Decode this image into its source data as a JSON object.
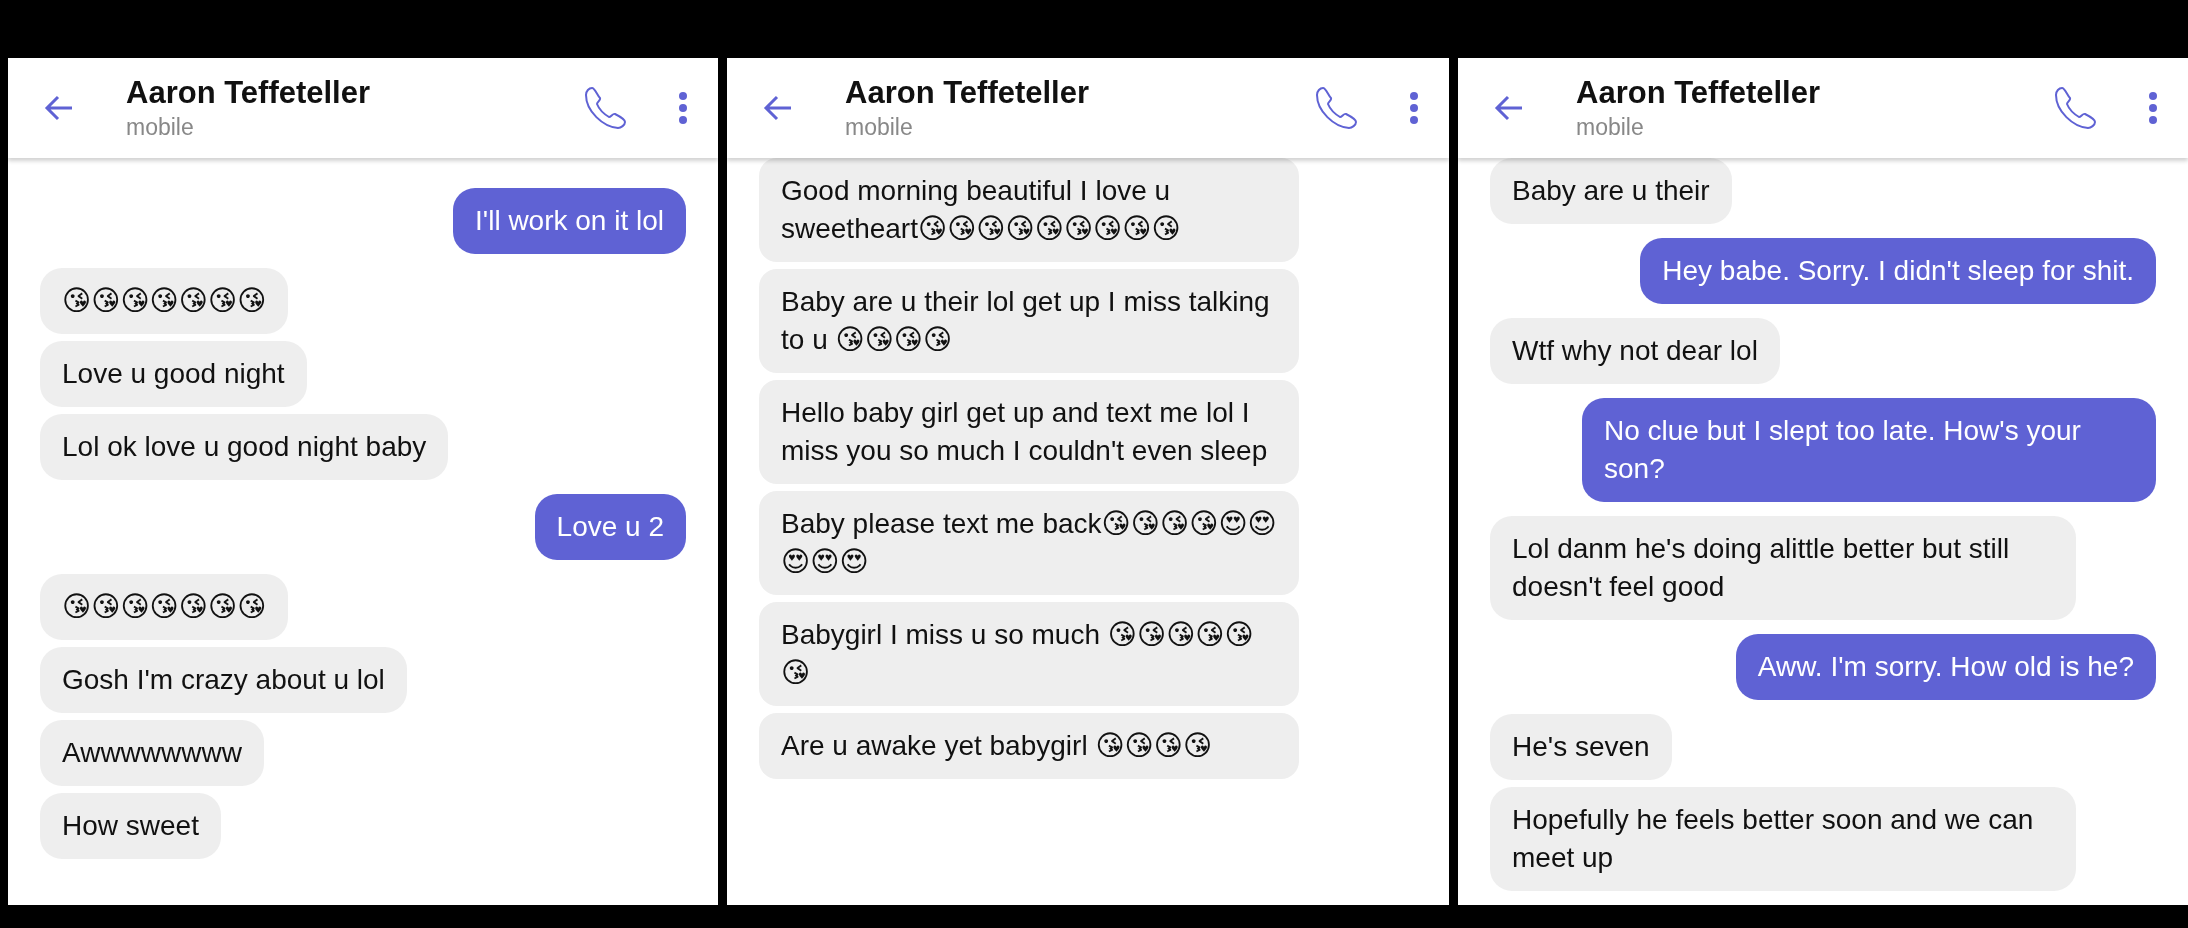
{
  "panels": [
    {
      "header": {
        "contact_name": "Aaron Teffeteller",
        "subtitle": "mobile"
      },
      "messages": [
        {
          "kind": "sent",
          "text": "I'll work on it lol"
        },
        {
          "kind": "received",
          "text": "😘😘😘😘😘😘😘"
        },
        {
          "kind": "received",
          "text": "Love u good night"
        },
        {
          "kind": "received",
          "text": "Lol ok love u good night baby"
        },
        {
          "kind": "sent",
          "text": "Love u 2"
        },
        {
          "kind": "received",
          "text": "😘😘😘😘😘😘😘"
        },
        {
          "kind": "received",
          "text": "Gosh I'm crazy about u lol"
        },
        {
          "kind": "received",
          "text": "Awwwwwwww"
        },
        {
          "kind": "received",
          "text": "How sweet"
        }
      ]
    },
    {
      "header": {
        "contact_name": "Aaron Teffeteller",
        "subtitle": "mobile"
      },
      "messages": [
        {
          "kind": "received",
          "text": "Good morning beautiful I love u sweetheart😘😘😘😘😘😘😘😘😘"
        },
        {
          "kind": "received",
          "text": "Baby are u their lol get up I miss talking to u 😘😘😘😘"
        },
        {
          "kind": "received",
          "text": "Hello baby girl get up and text me lol I miss you so much I couldn't even sleep"
        },
        {
          "kind": "received",
          "text": "Baby please text me back😘😘😘😘😍😍😍😍😍"
        },
        {
          "kind": "received",
          "text": "Babygirl I miss u so much 😘😘😘😘😘😘"
        },
        {
          "kind": "received",
          "text": "Are u awake yet babygirl 😘😘😘😘"
        }
      ]
    },
    {
      "header": {
        "contact_name": "Aaron Teffeteller",
        "subtitle": "mobile"
      },
      "messages": [
        {
          "kind": "received",
          "text": "Baby are u their"
        },
        {
          "kind": "sent",
          "text": "Hey babe. Sorry. I didn't sleep for shit."
        },
        {
          "kind": "received",
          "text": "Wtf why not dear lol"
        },
        {
          "kind": "sent",
          "text": "No clue but I slept too late. How's your son?"
        },
        {
          "kind": "received",
          "text": "Lol danm he's doing alittle better but still doesn't feel good"
        },
        {
          "kind": "sent",
          "text": "Aww. I'm sorry. How old is he?"
        },
        {
          "kind": "received",
          "text": "He's seven"
        },
        {
          "kind": "received",
          "text": "Hopefully he feels better soon and we can meet up"
        }
      ]
    }
  ]
}
